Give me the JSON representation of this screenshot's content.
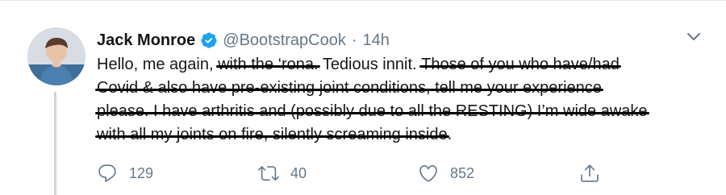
{
  "tweet": {
    "author_name": "Jack Monroe",
    "handle": "@BootstrapCook",
    "separator": "·",
    "time": "14h",
    "verified_icon": "verified-badge-icon",
    "avatar_icon": "avatar-photo",
    "text": {
      "p1": "Hello, me again,",
      "s1": "with the ‘rona.",
      "p2": "Tedious innit.",
      "s2": "Those of you who have/had",
      "s3": "Covid & also have pre-existing joint conditions, tell me your experience",
      "s4": "please. I have arthritis and (possibly due to all the RESTING) I’m wide awake",
      "s5": "with all my joints on fire, silently screaming inside",
      "end": "."
    },
    "actions": {
      "reply_count": "129",
      "retweet_count": "40",
      "like_count": "852"
    }
  },
  "colors": {
    "text": "#14171a",
    "secondary": "#657786",
    "verified": "#1da1f2",
    "divider": "#e6ecf0",
    "thread_line": "#cdd6dd"
  }
}
